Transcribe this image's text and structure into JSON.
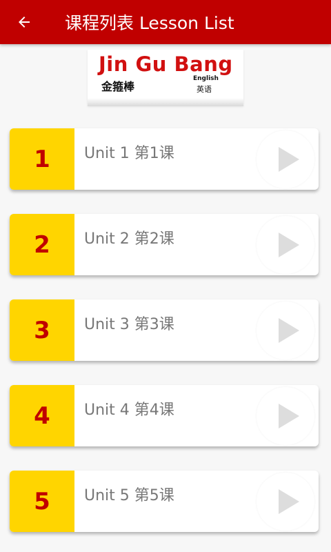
{
  "appbar": {
    "title": "课程列表 Lesson List",
    "back_icon": "arrow-left-icon",
    "background": "#c00000"
  },
  "logo": {
    "brand_text": "Jin Gu Bang",
    "brand_chinese": "金箍棒",
    "sub_english": "English",
    "sub_chinese": "英语"
  },
  "lessons": [
    {
      "number": "1",
      "title": "Unit 1 第1课"
    },
    {
      "number": "2",
      "title": "Unit 2 第2课"
    },
    {
      "number": "3",
      "title": "Unit 3 第3课"
    },
    {
      "number": "4",
      "title": "Unit 4 第4课"
    },
    {
      "number": "5",
      "title": "Unit 5 第5课"
    }
  ],
  "colors": {
    "number_bg": "#ffd500",
    "number_text": "#c00000",
    "play_icon": "#dddddd"
  }
}
